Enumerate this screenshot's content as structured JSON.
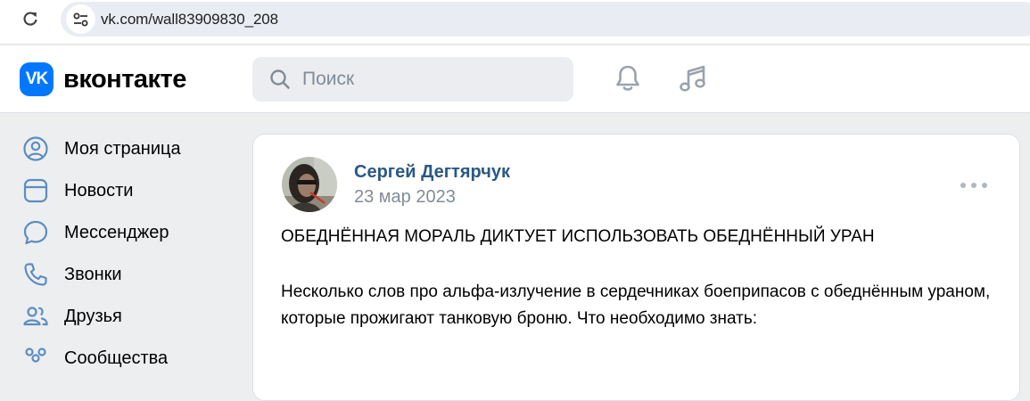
{
  "browser": {
    "url": "vk.com/wall83909830_208"
  },
  "header": {
    "logo_text": "вконтакте",
    "logo_mark": "VK",
    "search_placeholder": "Поиск",
    "brand_color": "#0077ff"
  },
  "nav": {
    "items": [
      {
        "label": "Моя страница",
        "icon": "user-circle-icon"
      },
      {
        "label": "Новости",
        "icon": "news-icon"
      },
      {
        "label": "Мессенджер",
        "icon": "message-bubble-icon"
      },
      {
        "label": "Звонки",
        "icon": "phone-icon"
      },
      {
        "label": "Друзья",
        "icon": "friends-icon"
      },
      {
        "label": "Сообщества",
        "icon": "communities-icon"
      }
    ]
  },
  "post": {
    "author": "Сергей Дегтярчук",
    "date": "23 мар 2023",
    "title": "ОБЕДНЁННАЯ МОРАЛЬ ДИКТУЕТ ИСПОЛЬЗОВАТЬ ОБЕДНЁННЫЙ УРАН",
    "body": "Несколько слов про альфа-излучение в сердечниках боеприпасов с обеднённым ураном, которые прожигают танковую броню. Что необходимо знать:"
  },
  "colors": {
    "link": "#2a5885",
    "secondary": "#818c99",
    "icon": "#5b8dc0"
  }
}
